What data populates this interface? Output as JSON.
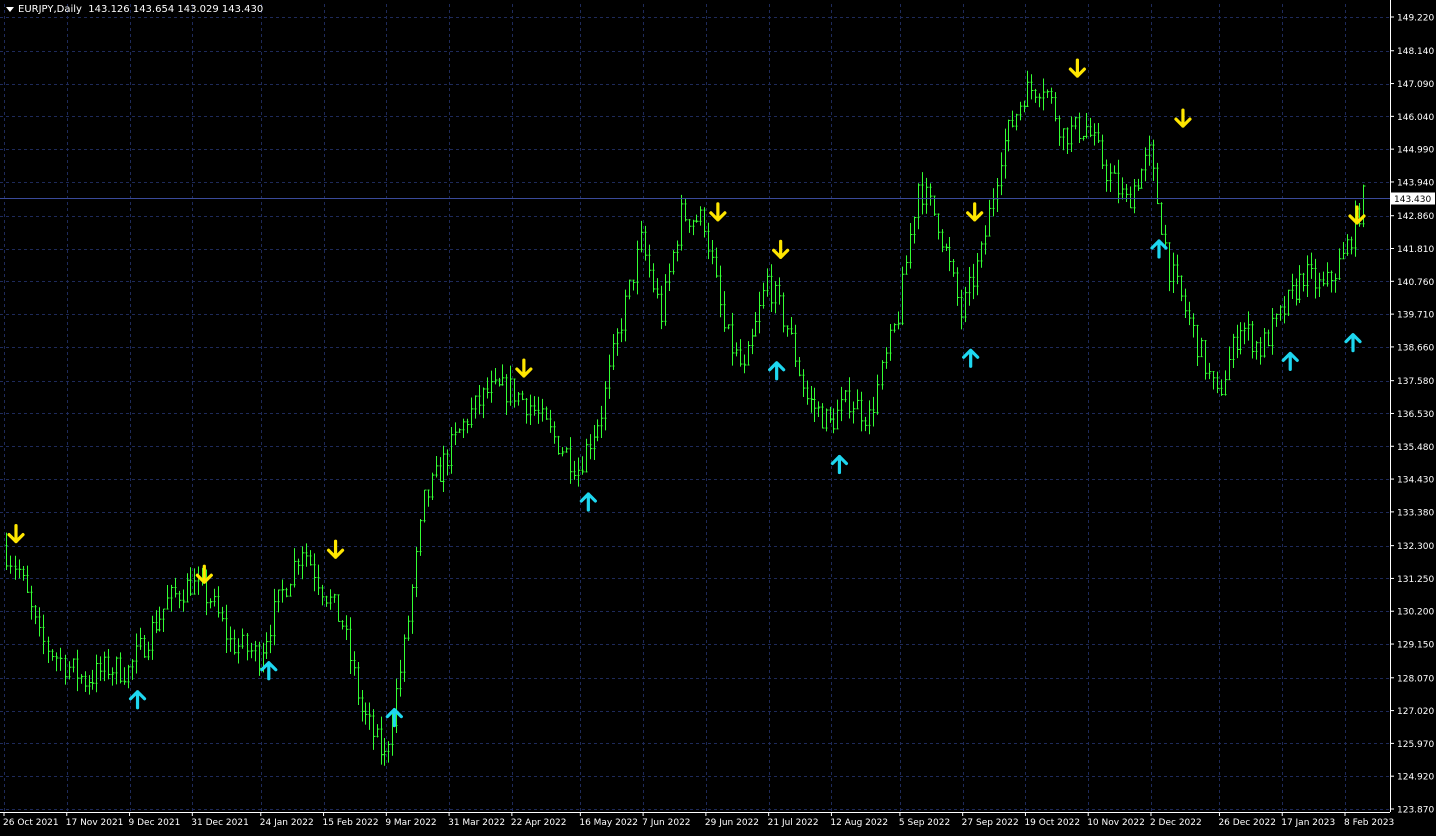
{
  "header": {
    "symbol": "EURJPY,Daily",
    "ohlc": "143.126 143.654 143.029 143.430"
  },
  "colors": {
    "background": "#000000",
    "grid": "#1e2a5a",
    "axis": "#ffffff",
    "candle": "#33ff33",
    "up_arrow": "#1ed7f0",
    "down_arrow": "#ffe600",
    "price_line": "#3a4a9a"
  },
  "chart_data": {
    "type": "line",
    "series": [
      {
        "x": [
          "26 Oct 2021",
          "1 Nov 2021",
          "8 Nov 2021",
          "17 Nov 2021",
          "24 Nov 2021",
          "2 Dec 2021",
          "9 Dec 2021",
          "16 Dec 2021",
          "23 Dec 2021",
          "31 Dec 2021",
          "7 Jan 2022",
          "14 Jan 2022",
          "24 Jan 2022",
          "1 Feb 2022",
          "8 Feb 2022",
          "15 Feb 2022",
          "22 Feb 2022",
          "1 Mar 2022",
          "9 Mar 2022",
          "16 Mar 2022",
          "23 Mar 2022",
          "31 Mar 2022",
          "7 Apr 2022",
          "14 Apr 2022",
          "22 Apr 2022",
          "29 Apr 2022",
          "6 May 2022",
          "16 May 2022",
          "24 May 2022",
          "31 May 2022",
          "7 Jun 2022",
          "14 Jun 2022",
          "21 Jun 2022",
          "29 Jun 2022",
          "6 Jul 2022",
          "13 Jul 2022",
          "21 Jul 2022",
          "28 Jul 2022",
          "4 Aug 2022",
          "12 Aug 2022",
          "19 Aug 2022",
          "26 Aug 2022",
          "5 Sep 2022",
          "12 Sep 2022",
          "19 Sep 2022",
          "27 Sep 2022",
          "4 Oct 2022",
          "11 Oct 2022",
          "19 Oct 2022",
          "26 Oct 2022",
          "2 Nov 2022",
          "10 Nov 2022",
          "17 Nov 2022",
          "24 Nov 2022",
          "2 Dec 2022",
          "9 Dec 2022",
          "16 Dec 2022",
          "26 Dec 2022",
          "3 Jan 2023",
          "10 Jan 2023",
          "17 Jan 2023",
          "25 Jan 2023",
          "1 Feb 2023",
          "8 Feb 2023",
          "15 Feb 2023"
        ],
        "values": [
          132.3,
          131.5,
          129.3,
          128.5,
          128.0,
          128.4,
          128.3,
          129.4,
          130.5,
          131.1,
          130.6,
          129.2,
          128.8,
          130.8,
          132.3,
          131.0,
          129.8,
          127.0,
          125.5,
          129.0,
          133.7,
          135.2,
          136.4,
          137.2,
          137.3,
          136.8,
          135.9,
          134.8,
          136.6,
          139.5,
          142.0,
          139.7,
          142.9,
          142.7,
          139.2,
          137.8,
          140.8,
          139.3,
          137.0,
          136.2,
          137.0,
          136.4,
          139.7,
          143.9,
          142.7,
          139.7,
          141.6,
          144.9,
          146.8,
          147.1,
          145.5,
          145.7,
          144.3,
          143.3,
          144.8,
          141.2,
          139.5,
          137.0,
          139.4,
          138.6,
          139.6,
          141.0,
          140.5,
          141.5,
          143.4
        ]
      }
    ],
    "x_ticks": [
      "26 Oct 2021",
      "17 Nov 2021",
      "9 Dec 2021",
      "31 Dec 2021",
      "24 Jan 2022",
      "15 Feb 2022",
      "9 Mar 2022",
      "31 Mar 2022",
      "22 Apr 2022",
      "16 May 2022",
      "7 Jun 2022",
      "29 Jun 2022",
      "21 Jul 2022",
      "12 Aug 2022",
      "5 Sep 2022",
      "27 Sep 2022",
      "19 Oct 2022",
      "10 Nov 2022",
      "2 Dec 2022",
      "26 Dec 2022",
      "17 Jan 2023",
      "8 Feb 2023"
    ],
    "y_ticks": [
      "149.220",
      "148.140",
      "147.090",
      "146.040",
      "144.990",
      "143.940",
      "142.860",
      "141.810",
      "140.760",
      "139.710",
      "138.660",
      "137.580",
      "136.530",
      "135.480",
      "134.430",
      "133.380",
      "132.300",
      "131.250",
      "130.200",
      "129.150",
      "128.070",
      "127.020",
      "125.970",
      "124.920",
      "123.870"
    ],
    "ylim": [
      123.87,
      149.22
    ],
    "current_price": "143.430",
    "up_arrows": [
      {
        "x": "9 Dec 2021",
        "y": 128.07
      },
      {
        "x": "24 Jan 2022",
        "y": 129.0
      },
      {
        "x": "9 Mar 2022",
        "y": 127.5
      },
      {
        "x": "16 May 2022",
        "y": 134.4
      },
      {
        "x": "21 Jul 2022",
        "y": 138.6
      },
      {
        "x": "12 Aug 2022",
        "y": 135.6
      },
      {
        "x": "27 Sep 2022",
        "y": 139.0
      },
      {
        "x": "2 Dec 2022",
        "y": 142.5
      },
      {
        "x": "17 Jan 2023",
        "y": 138.9
      },
      {
        "x": "8 Feb 2023",
        "y": 139.5
      }
    ],
    "down_arrows": [
      {
        "x": "26 Oct 2021",
        "y": 132.3
      },
      {
        "x": "31 Dec 2021",
        "y": 131.0
      },
      {
        "x": "15 Feb 2022",
        "y": 131.8
      },
      {
        "x": "22 Apr 2022",
        "y": 137.6
      },
      {
        "x": "29 Jun 2022",
        "y": 142.6
      },
      {
        "x": "21 Jul 2022",
        "y": 141.4
      },
      {
        "x": "27 Sep 2022",
        "y": 142.6
      },
      {
        "x": "2 Nov 2022",
        "y": 147.2
      },
      {
        "x": "9 Dec 2022",
        "y": 145.6
      },
      {
        "x": "8 Feb 2023",
        "y": 142.5
      }
    ]
  }
}
